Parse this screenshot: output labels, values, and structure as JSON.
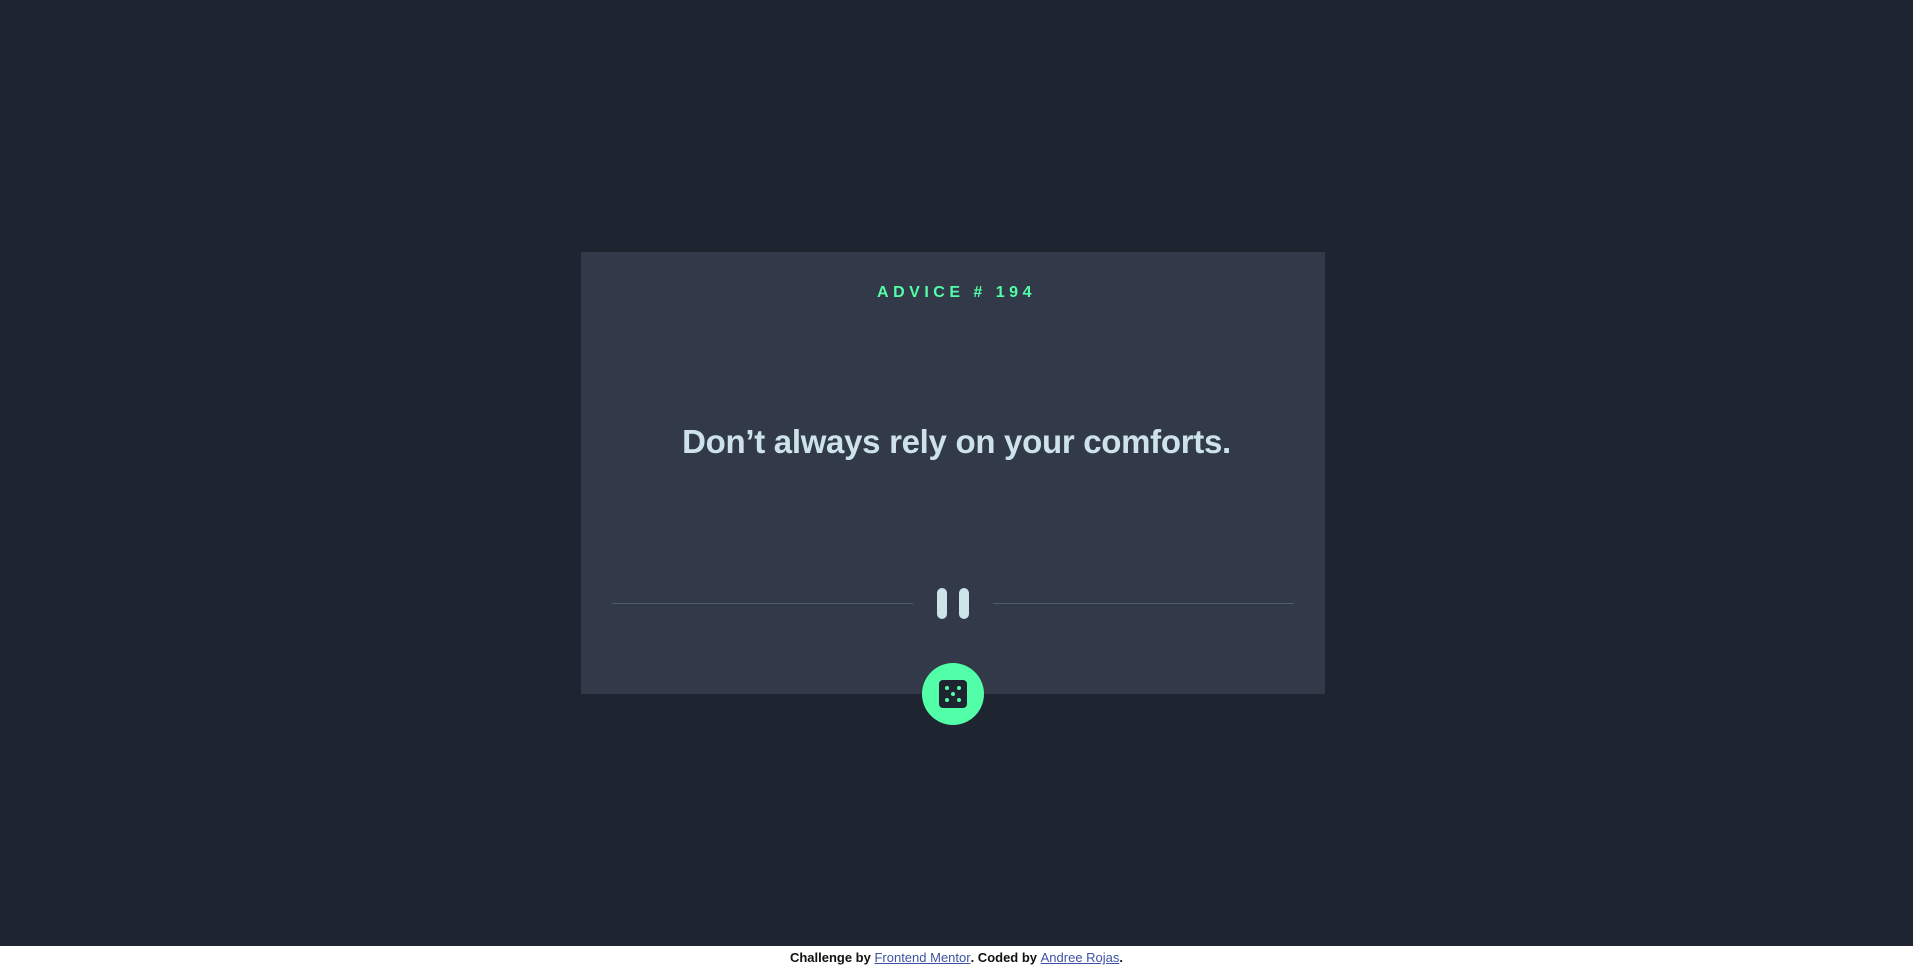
{
  "card": {
    "advice_label": "ADVICE # 194",
    "quote": "Don’t always rely on your comforts."
  },
  "icons": {
    "divider": "pause-icon",
    "dice": "dice-icon"
  },
  "colors": {
    "background": "#1f2530",
    "card": "#323a49",
    "accent": "#52ffa8",
    "text": "#cee3e9",
    "divider": "#4f5d74"
  },
  "footer": {
    "prefix": "Challenge by ",
    "link1": "Frontend Mentor",
    "middle": ". Coded by ",
    "link2": "Andree Rojas",
    "suffix": "."
  }
}
